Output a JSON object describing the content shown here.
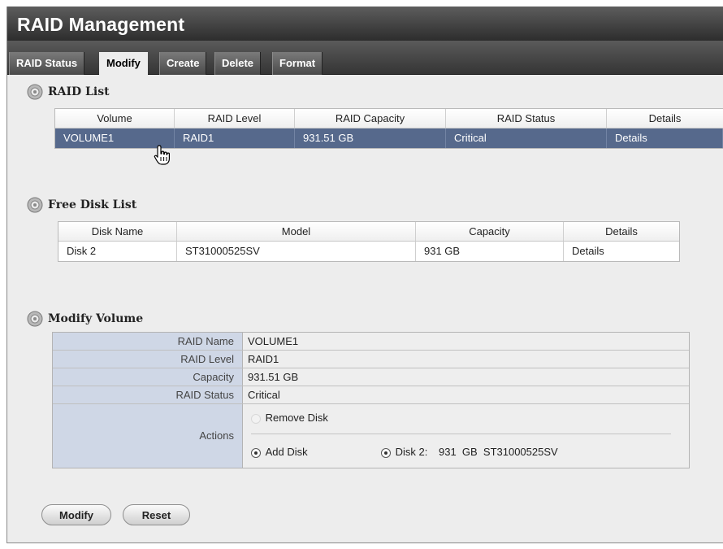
{
  "title": "RAID Management",
  "tabs": [
    {
      "label": "RAID Status",
      "active": false
    },
    {
      "label": "Modify",
      "active": true
    },
    {
      "label": "Create",
      "active": false
    },
    {
      "label": "Delete",
      "active": false
    },
    {
      "label": "Format",
      "active": false
    }
  ],
  "raid_list": {
    "heading": "RAID List",
    "columns": [
      "Volume",
      "RAID Level",
      "RAID Capacity",
      "RAID Status",
      "Details"
    ],
    "rows": [
      {
        "volume": "VOLUME1",
        "level": "RAID1",
        "capacity": "931.51 GB",
        "status": "Critical",
        "details": "Details"
      }
    ]
  },
  "free_disk_list": {
    "heading": "Free Disk List",
    "columns": [
      "Disk Name",
      "Model",
      "Capacity",
      "Details"
    ],
    "rows": [
      {
        "name": "Disk 2",
        "model": "ST31000525SV",
        "capacity": "931  GB",
        "details": "Details"
      }
    ]
  },
  "modify_volume": {
    "heading": "Modify Volume",
    "raid_name_label": "RAID Name",
    "raid_name": "VOLUME1",
    "raid_level_label": "RAID Level",
    "raid_level": "RAID1",
    "capacity_label": "Capacity",
    "capacity": "931.51 GB",
    "raid_status_label": "RAID Status",
    "raid_status": "Critical",
    "actions_label": "Actions",
    "remove_disk_label": "Remove Disk",
    "add_disk_label": "Add Disk",
    "disk_option_label": "Disk 2:",
    "disk_option_info": "931  GB  ST31000525SV"
  },
  "buttons": {
    "modify": "Modify",
    "reset": "Reset"
  },
  "icons": {
    "section": "gear-icon",
    "cursor": "hand-pointer-icon"
  },
  "colors": {
    "title_bar": "#3a3a3a",
    "selected_row": "#56698c",
    "form_label_bg": "#cfd7e6",
    "panel_bg": "#ededed"
  }
}
